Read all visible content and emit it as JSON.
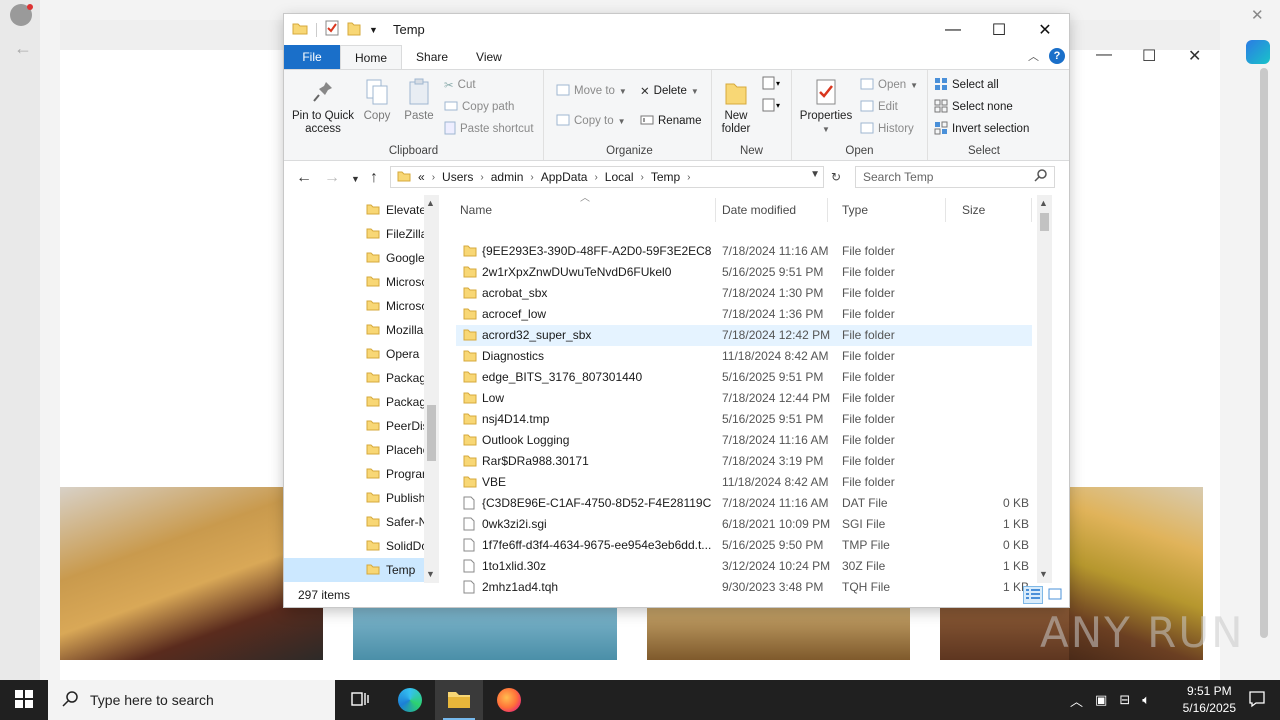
{
  "window": {
    "title": "Temp",
    "minimize_glyph": "—",
    "maximize_glyph": "☐",
    "close_glyph": "✕"
  },
  "tabs": [
    "File",
    "Home",
    "Share",
    "View"
  ],
  "ribbon": {
    "clipboard": {
      "label": "Clipboard",
      "pin": "Pin to Quick access",
      "copy": "Copy",
      "paste": "Paste",
      "cut": "Cut",
      "copy_path": "Copy path",
      "paste_shortcut": "Paste shortcut"
    },
    "organize": {
      "label": "Organize",
      "move_to": "Move to",
      "copy_to": "Copy to",
      "delete": "Delete",
      "rename": "Rename"
    },
    "new": {
      "label": "New",
      "new_folder": "New folder"
    },
    "open": {
      "label": "Open",
      "properties": "Properties",
      "open": "Open",
      "edit": "Edit",
      "history": "History"
    },
    "select": {
      "label": "Select",
      "select_all": "Select all",
      "select_none": "Select none",
      "invert": "Invert selection"
    }
  },
  "address": {
    "prefix": "«",
    "crumbs": [
      "Users",
      "admin",
      "AppData",
      "Local",
      "Temp"
    ],
    "search_placeholder": "Search Temp"
  },
  "nav_items": [
    {
      "label": "Elevate",
      "selected": false
    },
    {
      "label": "FileZilla",
      "selected": false
    },
    {
      "label": "Google",
      "selected": false
    },
    {
      "label": "Microsc",
      "selected": false
    },
    {
      "label": "Microsc",
      "selected": false
    },
    {
      "label": "Mozilla",
      "selected": false
    },
    {
      "label": "Opera",
      "selected": false
    },
    {
      "label": "Packag",
      "selected": false
    },
    {
      "label": "Packag",
      "selected": false
    },
    {
      "label": "PeerDis",
      "selected": false
    },
    {
      "label": "Placeho",
      "selected": false
    },
    {
      "label": "Prograr",
      "selected": false
    },
    {
      "label": "Publish",
      "selected": false
    },
    {
      "label": "Safer-N",
      "selected": false
    },
    {
      "label": "SolidDc",
      "selected": false
    },
    {
      "label": "Temp",
      "selected": true
    }
  ],
  "columns": {
    "name": "Name",
    "date": "Date modified",
    "type": "Type",
    "size": "Size"
  },
  "files": [
    {
      "name": "{9EE293E3-390D-48FF-A2D0-59F3E2EC88...",
      "date": "7/18/2024 11:16 AM",
      "type": "File folder",
      "size": "",
      "kind": "folder",
      "selected": false
    },
    {
      "name": "2w1rXpxZnwDUwuTeNvdD6FUkel0",
      "date": "5/16/2025 9:51 PM",
      "type": "File folder",
      "size": "",
      "kind": "folder",
      "selected": false
    },
    {
      "name": "acrobat_sbx",
      "date": "7/18/2024 1:30 PM",
      "type": "File folder",
      "size": "",
      "kind": "folder",
      "selected": false
    },
    {
      "name": "acrocef_low",
      "date": "7/18/2024 1:36 PM",
      "type": "File folder",
      "size": "",
      "kind": "folder",
      "selected": false
    },
    {
      "name": "acrord32_super_sbx",
      "date": "7/18/2024 12:42 PM",
      "type": "File folder",
      "size": "",
      "kind": "folder",
      "selected": true
    },
    {
      "name": "Diagnostics",
      "date": "11/18/2024 8:42 AM",
      "type": "File folder",
      "size": "",
      "kind": "folder",
      "selected": false
    },
    {
      "name": "edge_BITS_3176_807301440",
      "date": "5/16/2025 9:51 PM",
      "type": "File folder",
      "size": "",
      "kind": "folder",
      "selected": false
    },
    {
      "name": "Low",
      "date": "7/18/2024 12:44 PM",
      "type": "File folder",
      "size": "",
      "kind": "folder",
      "selected": false
    },
    {
      "name": "nsj4D14.tmp",
      "date": "5/16/2025 9:51 PM",
      "type": "File folder",
      "size": "",
      "kind": "folder",
      "selected": false
    },
    {
      "name": "Outlook Logging",
      "date": "7/18/2024 11:16 AM",
      "type": "File folder",
      "size": "",
      "kind": "folder",
      "selected": false
    },
    {
      "name": "Rar$DRa988.30171",
      "date": "7/18/2024 3:19 PM",
      "type": "File folder",
      "size": "",
      "kind": "folder",
      "selected": false
    },
    {
      "name": "VBE",
      "date": "11/18/2024 8:42 AM",
      "type": "File folder",
      "size": "",
      "kind": "folder",
      "selected": false
    },
    {
      "name": "{C3D8E96E-C1AF-4750-8D52-F4E28119C1...",
      "date": "7/18/2024 11:16 AM",
      "type": "DAT File",
      "size": "0 KB",
      "kind": "file",
      "selected": false
    },
    {
      "name": "0wk3zi2i.sgi",
      "date": "6/18/2021 10:09 PM",
      "type": "SGI File",
      "size": "1 KB",
      "kind": "file",
      "selected": false
    },
    {
      "name": "1f7fe6ff-d3f4-4634-9675-ee954e3eb6dd.t...",
      "date": "5/16/2025 9:50 PM",
      "type": "TMP File",
      "size": "0 KB",
      "kind": "file",
      "selected": false
    },
    {
      "name": "1to1xlid.30z",
      "date": "3/12/2024 10:24 PM",
      "type": "30Z File",
      "size": "1 KB",
      "kind": "file",
      "selected": false
    },
    {
      "name": "2mhz1ad4.tqh",
      "date": "9/30/2023 3:48 PM",
      "type": "TQH File",
      "size": "1 KB",
      "kind": "file",
      "selected": false
    }
  ],
  "status": {
    "item_count": "297 items"
  },
  "taskbar": {
    "search_placeholder": "Type here to search",
    "time": "9:51 PM",
    "date": "5/16/2025"
  },
  "watermark": "ANY RUN",
  "colors": {
    "accent": "#1a6fc9",
    "folder": "#f8d775",
    "selection": "#cce8ff",
    "taskbar": "#202020"
  }
}
